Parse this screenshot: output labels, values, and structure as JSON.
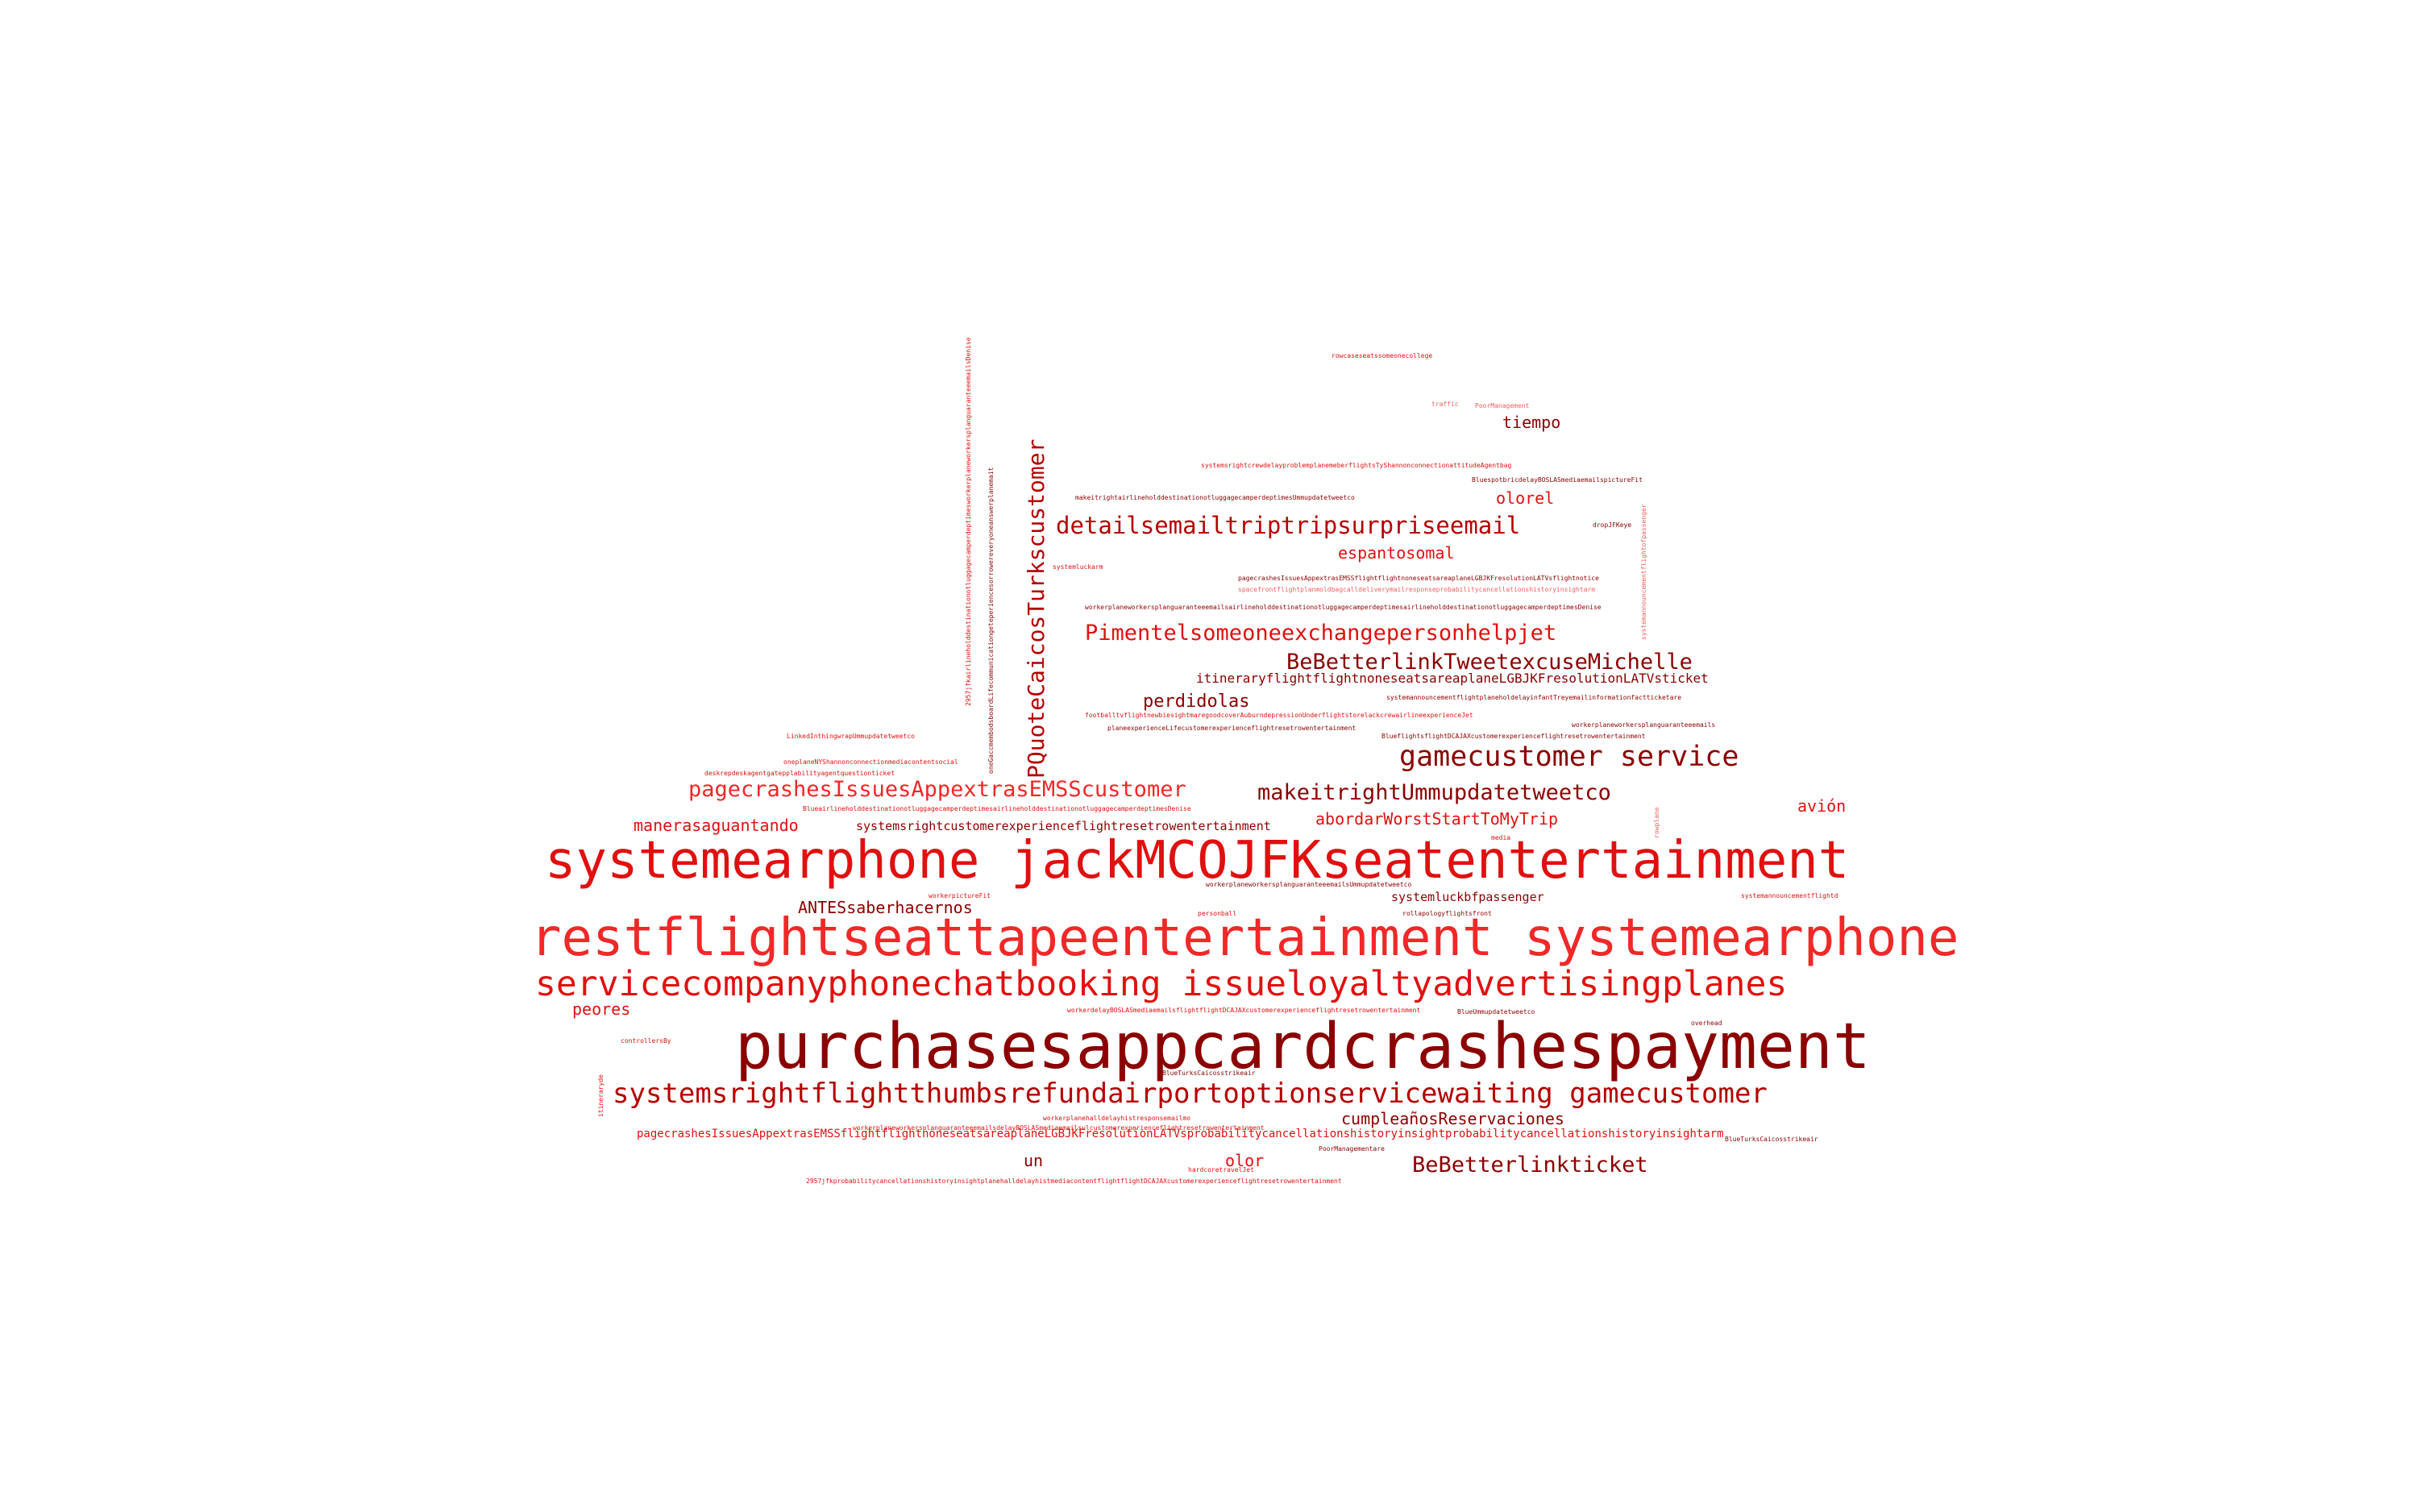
{
  "colors": {
    "background": "#ffffff",
    "dark_red": "#8b0000",
    "mid_red": "#b30000",
    "red": "#e01010",
    "bright_red": "#f02828",
    "light_red": "#f06060"
  },
  "words": [
    "purchasesappcardcrashespayment",
    "restflightseattapeentertainment systemearphone",
    "systemearphone jackMCOJFKseatentertainment",
    "servicecompanyphonechatbooking issueloyaltyadvertisingplanes",
    "systemsrightflightthumbsrefundairportoptionservicewaiting gamecustomer",
    "gamecustomer service",
    "PQuoteCaicosTurkscustomer",
    "detailsemailtriptripsurpriseemail",
    "pagecrashesIssuesAppextrasEMSScustomer",
    "makeitrightUmmupdatetweetco",
    "Pimentelsomeoneexchangepersonhelpjet",
    "BeBetterlinkTweetexcuseMichelle",
    "BeBetterlinkticket",
    "tiempo",
    "olorel",
    "espantosomal",
    "perdidolas",
    "abordarWorstStartToMyTrip",
    "manerasaguantando",
    "ANTESsaberhacernos",
    "cumpleañosReservaciones",
    "avión",
    "peores",
    "un",
    "olor",
    "itineraryflightflightnoneseatsareaplaneLGBJKFresolutionLATVsticket",
    "systemsrightcustomerexperienceflightresetrowentertainment",
    "pagecrashesIssuesAppextrasEMSSflightflightnoneseatsareaplaneLGBJKFresolutionLATVsprobabilitycancellationshistoryinsightprobabilitycancellationshistoryinsightarm",
    "systemluckbfpassenger",
    "rowcaseseatssomeonecollege",
    "traffic",
    "PoorManagement",
    "systemsrightcrewdelayproblemplanemeberflightsTyShannonconnectionattitudeAgentbag",
    "BluespotbricdelayBOSLASmediaemailspictureFit",
    "makeitrightairlineholddestinationotluggagecamperdeptimesUmmupdatetweetco",
    "dropJFKeye",
    "systemluckarm",
    "pagecrashesIssuesAppextrasEMSSflightflightnoneseatsareaplaneLGBJKFresolutionLATVsflightnotice",
    "spacefrontflightplanmoldbagcalldeliverymailresponseprobabilitycancellationshistoryinsightarm",
    "workerplaneworkersplanguaranteeemailsairlineholddestinationotluggagecamperdeptimesairlineholddestinationotluggagecamperdeptimesDenise",
    "systemannouncementflightplaneholdelayinfantTreyemailinformationfactticketare",
    "footballtvflightnewbiesightmaregoodcoverAuburndepressionUnderflightstorelackcrewairlineexperienceJet",
    "planeexperienceLifecustomerexperienceflightresetrowentertainment",
    "BlueflightsflightDCAJAXcustomerexperienceflightresetrowentertainment",
    "workerplaneworkersplanguaranteeemails",
    "LinkedInthingwrapUmmupdatetweetco",
    "oneplaneNYShannonconnectionmediacontentsocial",
    "deskrepdeskagentgatepplabilityagentquestionticket",
    "BlueairlineholddestinationotluggagecamperdeptimesairlineholddestinationotluggagecamperdeptimesDenise",
    "media",
    "workerpictureFit",
    "workerplaneworkersplanguaranteeemailsUmmupdatetweetco",
    "personball",
    "rollapologyflightsfront",
    "systemannouncementflightd",
    "controllersBy",
    "workerdelayBOSLASmediaemailsflightflightDCAJAXcustomerexperienceflightresetrowentertainment",
    "BlueUmmupdatetweetco",
    "overhead",
    "BlueTurksCaicosstrikeair",
    "itineraryde",
    "workerplanehalldelayhistresponsemailmo",
    "workerplaneworkersplanguaranteeemailsdelayBOSLASmediaemailsulcustomerexperienceflightresetrowentertainment",
    "hardcoretravelJet",
    "PoorManagementare",
    "2957jfkprobabilitycancellationshistoryinsightplanehalldelayhistmediacontentflightflightDCAJAXcustomerexperienceflightresetrowentertainment",
    "2957jfkairlineholddestinationotluggagecamperdeptimesworkerplaneworkersplanguaranteeemailsDenise",
    "oneGaccmembodsboardLifecommunicationgeteperiencesorrowereveryoneanswerplanemait",
    "systemannouncementflightofpassenger",
    "rowplane",
    "BlueTurksCaicosstrikeair"
  ]
}
